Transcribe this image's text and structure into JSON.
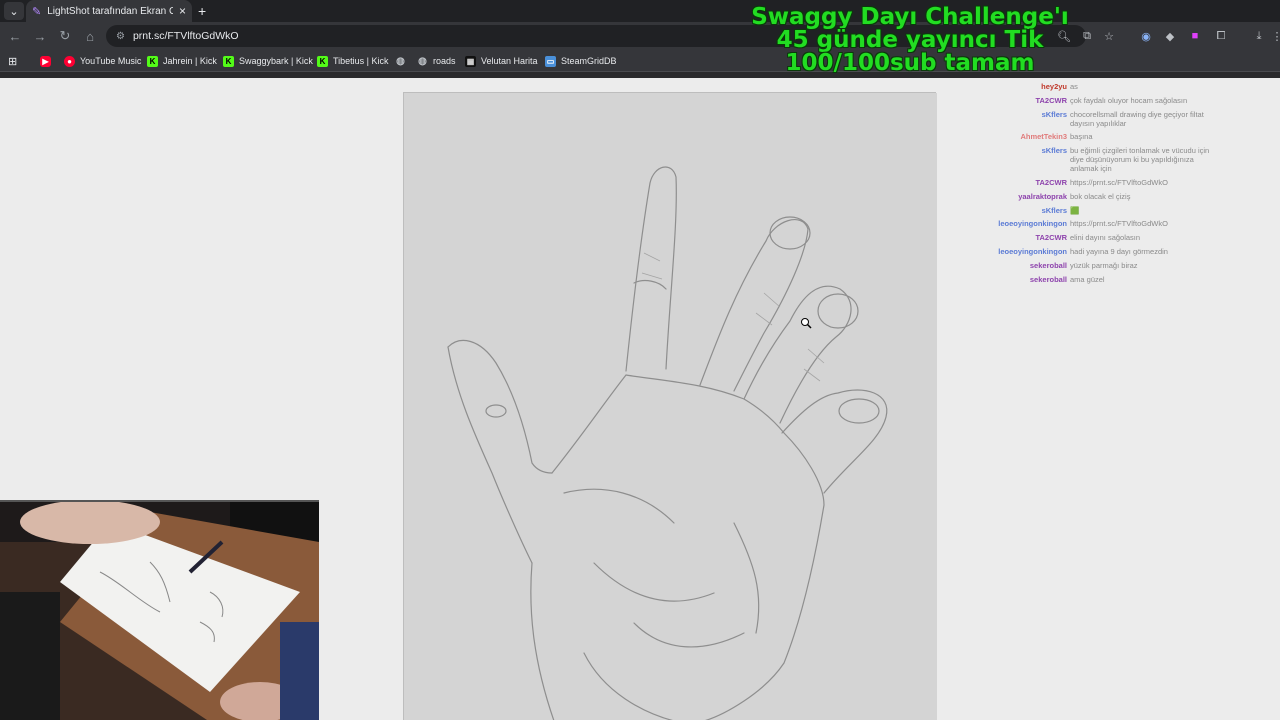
{
  "browser": {
    "tab_title": "LightShot tarafından Ekran Gör",
    "url": "prnt.sc/FTVlftoGdWkO"
  },
  "bookmarks": [
    {
      "label": "YouTube Music",
      "icon": "youtube-music-icon",
      "color": "#ff0033"
    },
    {
      "label": "Jahrein | Kick",
      "icon": "kick-icon",
      "color": "#53fc18"
    },
    {
      "label": "Swaggybark | Kick",
      "icon": "kick-icon",
      "color": "#53fc18"
    },
    {
      "label": "Tibetius | Kick",
      "icon": "kick-icon",
      "color": "#53fc18"
    },
    {
      "label": "roads",
      "icon": "globe-icon",
      "color": "#9aa0a6"
    },
    {
      "label": "Velutan Harita",
      "icon": "map-icon",
      "color": "#dddddd"
    },
    {
      "label": "SteamGridDB",
      "icon": "steamgrid-icon",
      "color": "#4a90d9"
    }
  ],
  "overlay": {
    "line1": "Swaggy Dayı Challenge'ı",
    "line2": "45 günde yayıncı Tik",
    "line3": "100/100sub tamam"
  },
  "chat": [
    {
      "user": "hey2yu",
      "text": "as",
      "color": "#c0392b"
    },
    {
      "user": "TA2CWR",
      "text": "çok faydalı oluyor hocam sağolasın",
      "color": "#8e44ad"
    },
    {
      "user": "sKflers",
      "text": "chocorellsmall drawing diye geçiyor filtat dayısın yapılıklar",
      "color": "#5b7bd5"
    },
    {
      "user": "AhmetTekin3",
      "text": "başına",
      "color": "#e07b7b"
    },
    {
      "user": "sKflers",
      "text": "bu eğimli çizgileri tonlamak ve vücudu için diye düşünüyorum ki bu yapıldığınıza anlamak için",
      "color": "#5b7bd5"
    },
    {
      "user": "TA2CWR",
      "text": "https://prnt.sc/FTVlftoGdWkO",
      "color": "#8e44ad"
    },
    {
      "user": "yaalraktoprak",
      "text": "bok olacak el çiziş",
      "color": "#8e44ad"
    },
    {
      "user": "sKflers",
      "text": "🟩",
      "color": "#5b7bd5"
    },
    {
      "user": "leoeoyingonkingon",
      "text": "https://prnt.sc/FTVlftoGdWkO",
      "color": "#5b7bd5"
    },
    {
      "user": "TA2CWR",
      "text": "elini dayını sağolasın",
      "color": "#8e44ad"
    },
    {
      "user": "leoeoyingonkingon",
      "text": "hadi yayına 9 dayı görmezdin",
      "color": "#5b7bd5"
    },
    {
      "user": "sekeroball",
      "text": "yüzük parmağı biraz",
      "color": "#8e44ad"
    },
    {
      "user": "sekeroball",
      "text": "ama güzel",
      "color": "#8e44ad"
    }
  ]
}
